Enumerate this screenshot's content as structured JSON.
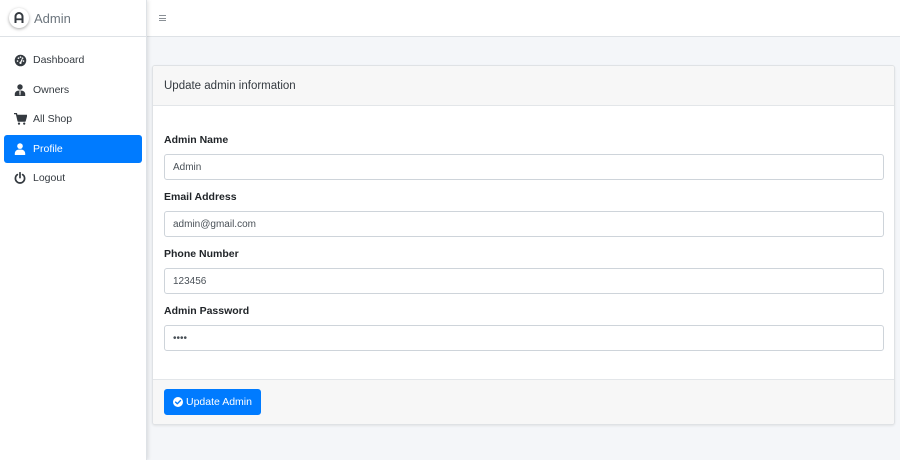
{
  "brand": {
    "name": "Admin",
    "logo_icon": "letter-a-logo"
  },
  "sidebar": {
    "items": [
      {
        "label": "Dashboard",
        "icon": "tachometer-icon",
        "active": false
      },
      {
        "label": "Owners",
        "icon": "user-tie-icon",
        "active": false
      },
      {
        "label": "All Shop",
        "icon": "shopping-cart-icon",
        "active": false
      },
      {
        "label": "Profile",
        "icon": "user-icon",
        "active": true
      },
      {
        "label": "Logout",
        "icon": "power-icon",
        "active": false
      }
    ]
  },
  "topbar": {
    "menu_icon": "hamburger-icon"
  },
  "form": {
    "title": "Update admin information",
    "fields": [
      {
        "label": "Admin Name",
        "value": "Admin",
        "type": "text"
      },
      {
        "label": "Email Address",
        "value": "admin@gmail.com",
        "type": "email"
      },
      {
        "label": "Phone Number",
        "value": "123456",
        "type": "text"
      },
      {
        "label": "Admin Password",
        "value": "1234",
        "type": "password"
      }
    ],
    "submit_label": "Update Admin",
    "submit_icon": "check-circle-icon"
  },
  "colors": {
    "primary": "#007bff",
    "background": "#f4f6f9",
    "sidebar_bg": "#ffffff",
    "card_header_bg": "#f7f7f7"
  }
}
